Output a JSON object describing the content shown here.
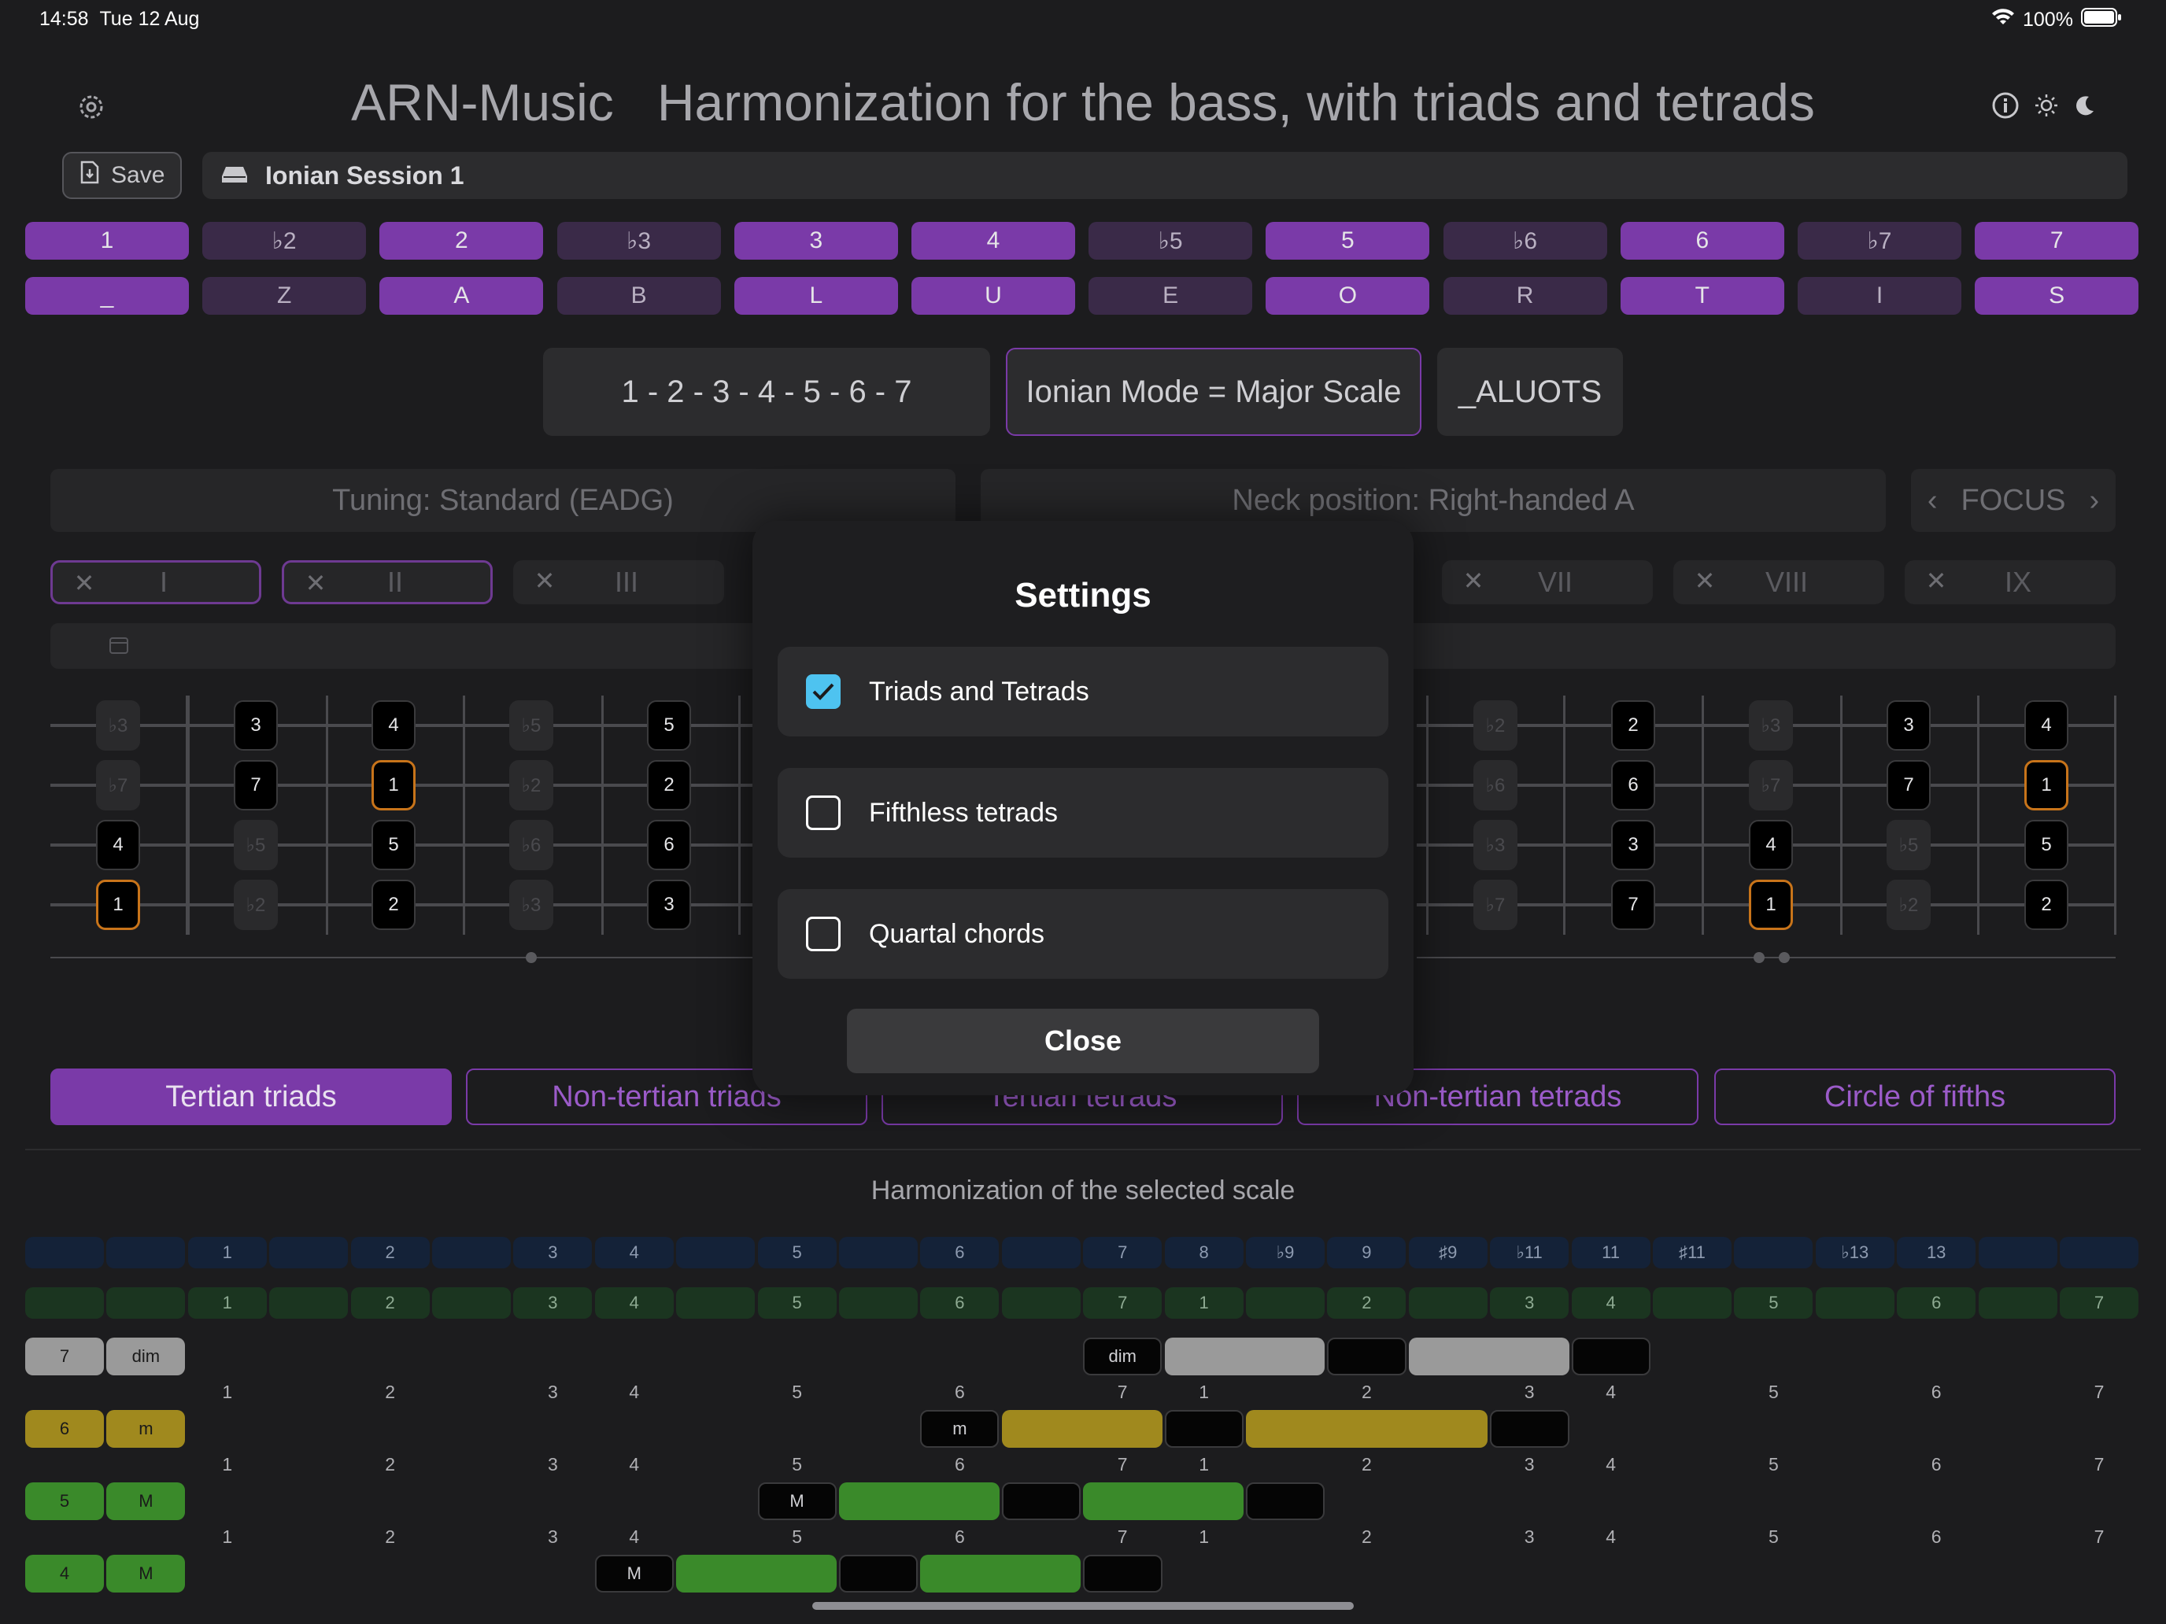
{
  "status": {
    "time": "14:58",
    "date": "Tue 12 Aug",
    "battery": "100%"
  },
  "header": {
    "app": "ARN-Music",
    "subtitle": "Harmonization for the bass, with triads and tetrads"
  },
  "toolbar": {
    "save_label": "Save",
    "session_name": "Ionian Session 1"
  },
  "degrees": [
    {
      "label": "1",
      "on": true
    },
    {
      "label": "♭2",
      "on": false
    },
    {
      "label": "2",
      "on": true
    },
    {
      "label": "♭3",
      "on": false
    },
    {
      "label": "3",
      "on": true
    },
    {
      "label": "4",
      "on": true
    },
    {
      "label": "♭5",
      "on": false
    },
    {
      "label": "5",
      "on": true
    },
    {
      "label": "♭6",
      "on": false
    },
    {
      "label": "6",
      "on": true
    },
    {
      "label": "♭7",
      "on": false
    },
    {
      "label": "7",
      "on": true
    }
  ],
  "letters": [
    "_",
    "Z",
    "A",
    "B",
    "L",
    "U",
    "E",
    "O",
    "R",
    "T",
    "I",
    "S"
  ],
  "summary": {
    "formula": "1 - 2 - 3 - 4 - 5 - 6 - 7",
    "mode": "Ionian Mode = Major Scale",
    "code": "_ALUOTS"
  },
  "controls": {
    "tuning": "Tuning: Standard (EADG)",
    "neck": "Neck position: Right-handed A",
    "focus": "FOCUS"
  },
  "positions": [
    "I",
    "II",
    "III",
    "VII",
    "VIII",
    "IX"
  ],
  "fretboard_left": [
    [
      "♭3",
      "3",
      "4",
      "♭5",
      "5"
    ],
    [
      "♭7",
      "7",
      "1",
      "♭2",
      "2"
    ],
    [
      "4",
      "♭5",
      "5",
      "♭6",
      "6"
    ],
    [
      "1",
      "♭2",
      "2",
      "♭3",
      "3"
    ]
  ],
  "fretboard_right": [
    [
      "♭2",
      "2",
      "♭3",
      "3",
      "4"
    ],
    [
      "♭6",
      "6",
      "♭7",
      "7",
      "1"
    ],
    [
      "♭3",
      "3",
      "4",
      "♭5",
      "5"
    ],
    [
      "♭7",
      "7",
      "1",
      "♭2",
      "2"
    ]
  ],
  "tabs": [
    "Tertian triads",
    "Non-tertian triads",
    "Tertian tetrads",
    "Non-tertian tetrads",
    "Circle of fifths"
  ],
  "harmonization": {
    "title": "Harmonization of the selected scale",
    "interval_row": [
      "",
      "",
      "1",
      "",
      "2",
      "",
      "3",
      "4",
      "",
      "5",
      "",
      "6",
      "",
      "7",
      "8",
      "♭9",
      "9",
      "♯9",
      "♭11",
      "11",
      "♯11",
      "",
      "♭13",
      "13",
      "",
      ""
    ],
    "degree_row": [
      "",
      "",
      "1",
      "",
      "2",
      "",
      "3",
      "4",
      "",
      "5",
      "",
      "6",
      "",
      "7",
      "1",
      "",
      "2",
      "",
      "3",
      "4",
      "",
      "5",
      "",
      "6",
      "",
      "7"
    ],
    "scale_labels": [
      "1",
      "2",
      "3",
      "4",
      "5",
      "6",
      "7",
      "1",
      "2",
      "3",
      "4",
      "5",
      "6",
      "7"
    ],
    "chords": [
      {
        "degree": "7",
        "quality": "dim",
        "color": "#9a9a9a"
      },
      {
        "degree": "6",
        "quality": "m",
        "color": "#a0891e"
      },
      {
        "degree": "5",
        "quality": "M",
        "color": "#3a8a2a"
      },
      {
        "degree": "4",
        "quality": "M",
        "color": "#3a8a2a"
      }
    ]
  },
  "settings": {
    "title": "Settings",
    "options": [
      {
        "label": "Triads and Tetrads",
        "checked": true
      },
      {
        "label": "Fifthless tetrads",
        "checked": false
      },
      {
        "label": "Quartal chords",
        "checked": false
      }
    ],
    "close_label": "Close"
  },
  "colors": {
    "accent": "#7a3aa8",
    "checkbox": "#4ec3f0",
    "root_outline": "#c8741a"
  }
}
